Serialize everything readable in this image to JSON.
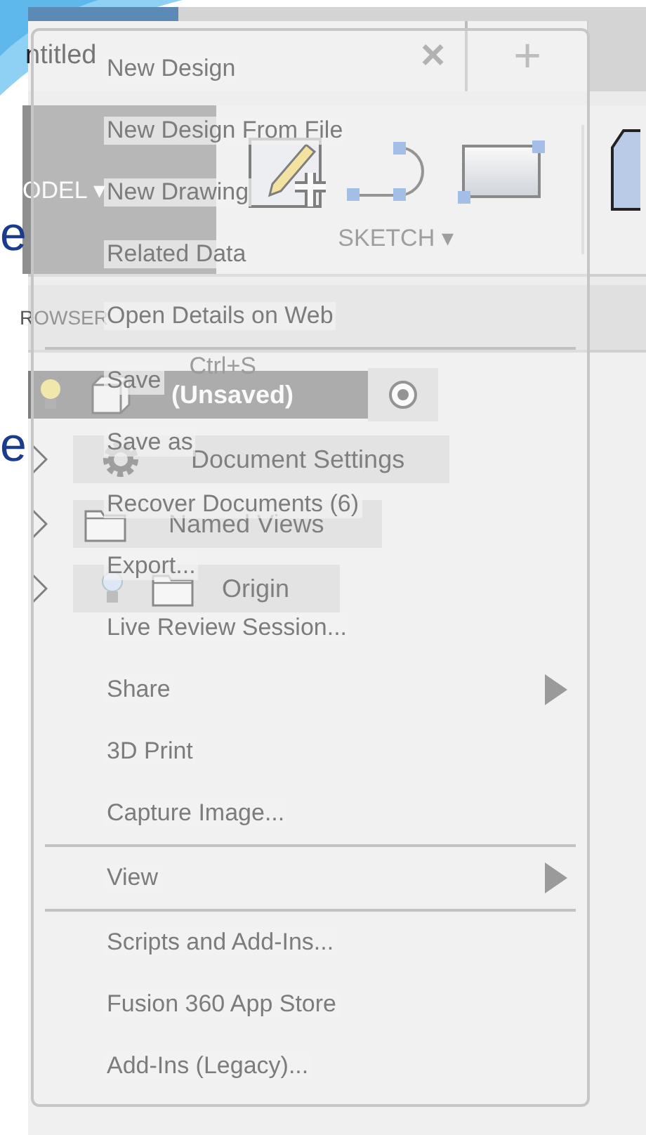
{
  "slide": {
    "letters": [
      "e",
      "e"
    ]
  },
  "app": {
    "document_tab": {
      "title": "ntitled",
      "close": "×"
    },
    "new_tab": "+",
    "workspace": {
      "label": "ODEL",
      "caret": "▾"
    },
    "toolbar": {
      "group_label": "SKETCH",
      "caret": "▾"
    },
    "browser": {
      "title": "ROWSER"
    },
    "tree": [
      {
        "kind": "root",
        "label": "(Unsaved)",
        "selected": true,
        "active": true
      },
      {
        "kind": "settings",
        "label": "Document Settings",
        "selected": false
      },
      {
        "kind": "views",
        "label": "Named Views",
        "selected": false
      },
      {
        "kind": "origin",
        "label": "Origin",
        "selected": false
      }
    ]
  },
  "menu": {
    "items": [
      {
        "kind": "item",
        "label": "New Design"
      },
      {
        "kind": "item",
        "label": "New Design From File"
      },
      {
        "kind": "item",
        "label": "New Drawing"
      },
      {
        "kind": "item",
        "label": "Related Data"
      },
      {
        "kind": "item",
        "label": "Open Details on Web"
      },
      {
        "kind": "separator"
      },
      {
        "kind": "item",
        "label": "Save",
        "shortcut": "Ctrl+S"
      },
      {
        "kind": "item",
        "label": "Save as"
      },
      {
        "kind": "item",
        "label": "Recover Documents (6)"
      },
      {
        "kind": "item",
        "label": "Export..."
      },
      {
        "kind": "item",
        "label": "Live Review Session..."
      },
      {
        "kind": "submenu",
        "label": "Share"
      },
      {
        "kind": "item",
        "label": "3D Print"
      },
      {
        "kind": "item",
        "label": "Capture Image..."
      },
      {
        "kind": "separator"
      },
      {
        "kind": "submenu",
        "label": "View"
      },
      {
        "kind": "separator"
      },
      {
        "kind": "item",
        "label": "Scripts and Add-Ins..."
      },
      {
        "kind": "item",
        "label": "Fusion 360 App Store"
      },
      {
        "kind": "item",
        "label": "Add-Ins (Legacy)..."
      }
    ]
  }
}
